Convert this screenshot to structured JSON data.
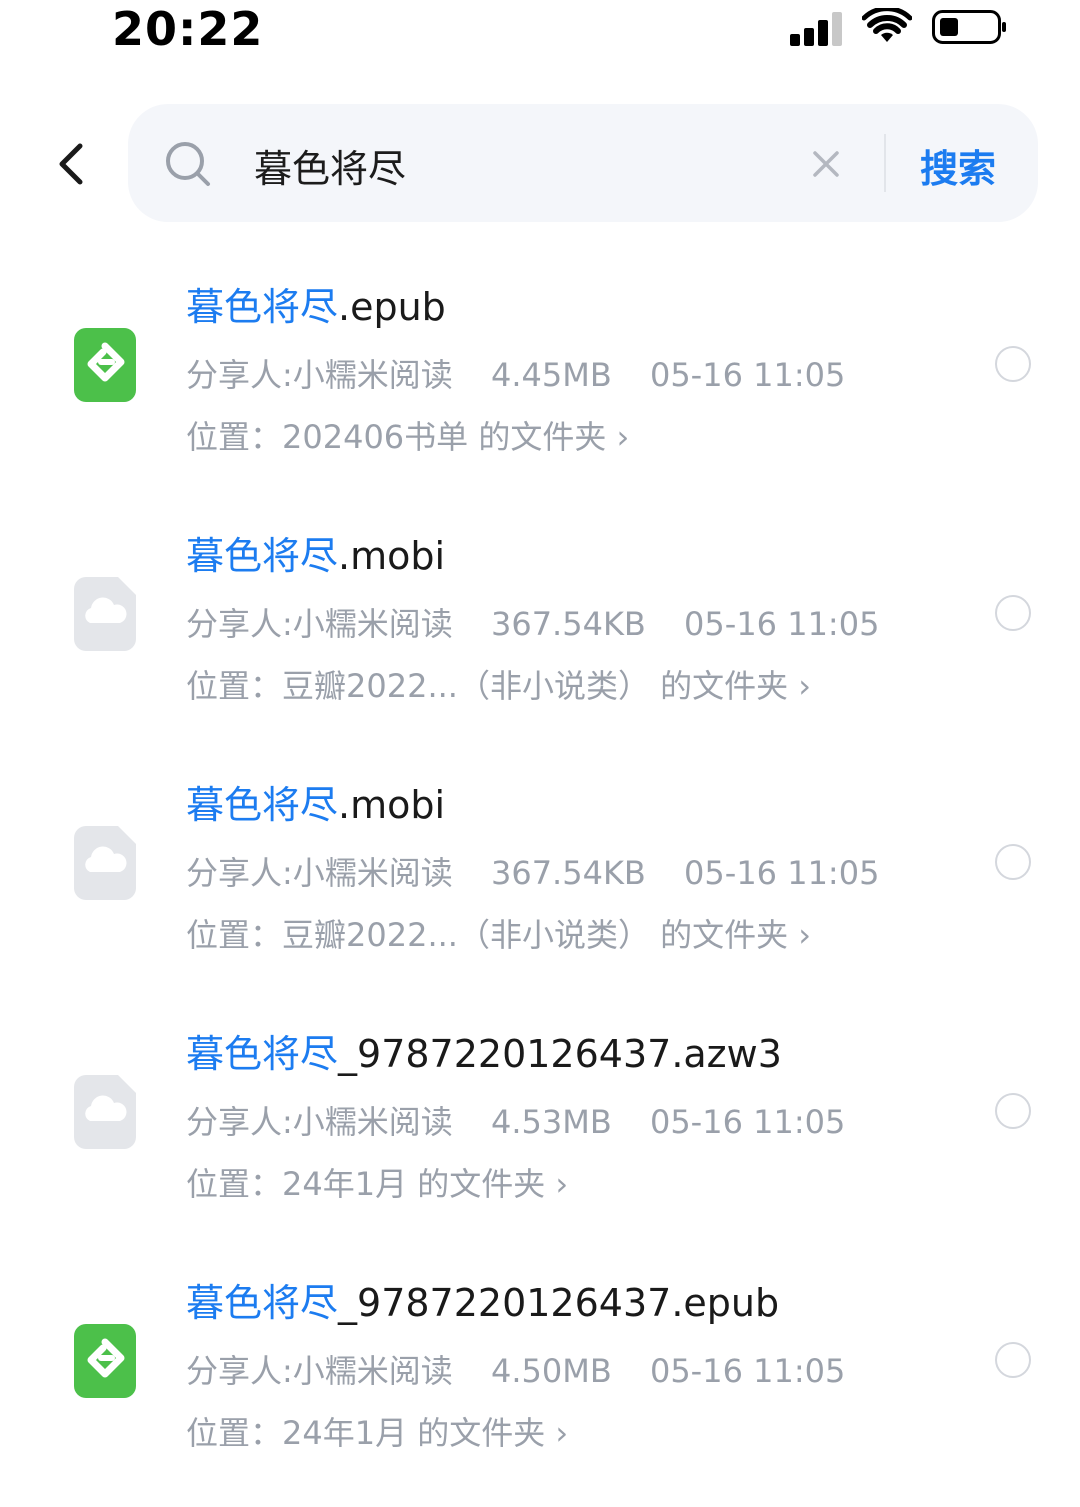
{
  "status_bar": {
    "time": "20:22"
  },
  "search": {
    "query": "暮色将尽",
    "submit_label": "搜索"
  },
  "results": [
    {
      "name_highlight": "暮色将尽",
      "name_rest": ".epub",
      "file_type": "epub-icon",
      "sharer": "分享人:小糯米阅读",
      "size": "4.45MB",
      "date": "05-16 11:05",
      "location": "位置：202406书单 的文件夹 ›"
    },
    {
      "name_highlight": "暮色将尽",
      "name_rest": ".mobi",
      "file_type": "cloud-file-icon",
      "sharer": "分享人:小糯米阅读",
      "size": "367.54KB",
      "date": "05-16 11:05",
      "location": "位置：豆瓣2022...（非小说类） 的文件夹 ›"
    },
    {
      "name_highlight": "暮色将尽",
      "name_rest": ".mobi",
      "file_type": "cloud-file-icon",
      "sharer": "分享人:小糯米阅读",
      "size": "367.54KB",
      "date": "05-16 11:05",
      "location": "位置：豆瓣2022...（非小说类） 的文件夹 ›"
    },
    {
      "name_highlight": "暮色将尽",
      "name_rest": "_9787220126437.azw3",
      "file_type": "cloud-file-icon",
      "sharer": "分享人:小糯米阅读",
      "size": "4.53MB",
      "date": "05-16 11:05",
      "location": "位置：24年1月 的文件夹 ›"
    },
    {
      "name_highlight": "暮色将尽",
      "name_rest": "_9787220126437.epub",
      "file_type": "epub-icon",
      "sharer": "分享人:小糯米阅读",
      "size": "4.50MB",
      "date": "05-16 11:05",
      "location": "位置：24年1月 的文件夹 ›"
    }
  ],
  "colors": {
    "accent": "#1c7cf0",
    "epub_green": "#4cc04a",
    "cloud_grey": "#e4e6ea",
    "meta_text": "#9aa0aa"
  }
}
